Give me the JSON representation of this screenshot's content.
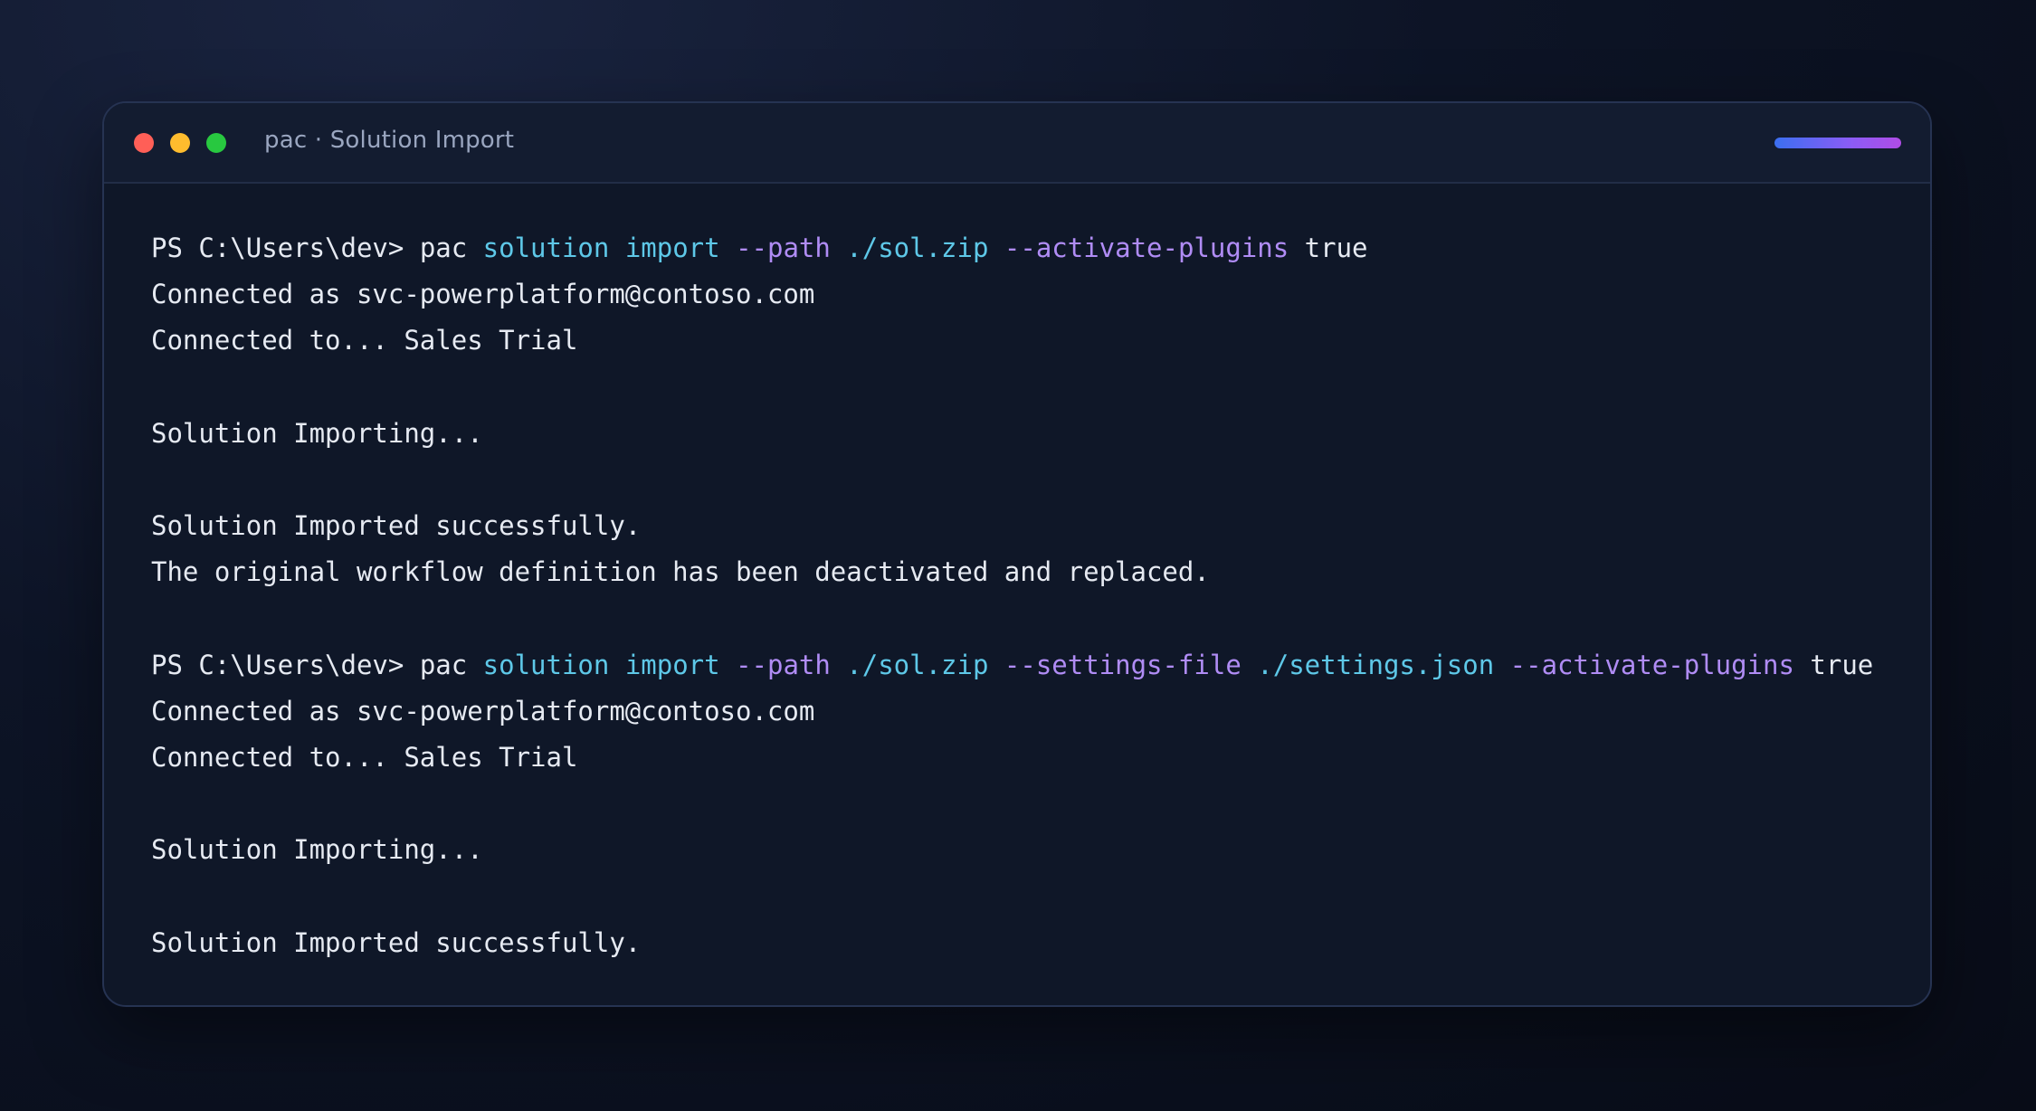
{
  "window": {
    "title": "pac · Solution Import"
  },
  "colors": {
    "command": "#5ec8e8",
    "flag": "#b08cf5",
    "text": "#e6eaf2",
    "close": "#ff5f57",
    "minimize": "#febc2e",
    "maximize": "#28c840"
  },
  "terminal": {
    "cmd1": {
      "prompt": "PS C:\\Users\\dev> ",
      "program": "pac",
      "sub1": "solution",
      "sub2": "import",
      "flag1": "--path",
      "arg1": "./sol.zip",
      "flag2": "--activate-plugins",
      "val2": "true"
    },
    "out1": [
      "Connected as svc-powerplatform@contoso.com",
      "Connected to... Sales Trial",
      "",
      "Solution Importing...",
      "",
      "Solution Imported successfully.",
      "The original workflow definition has been deactivated and replaced.",
      ""
    ],
    "cmd2": {
      "prompt": "PS C:\\Users\\dev> ",
      "program": "pac",
      "sub1": "solution",
      "sub2": "import",
      "flag1": "--path",
      "arg1": "./sol.zip",
      "flag2": "--settings-file",
      "arg2": "./settings.json",
      "flag3": "--activate-plugins",
      "val3": "true"
    },
    "out2": [
      "Connected as svc-powerplatform@contoso.com",
      "Connected to... Sales Trial",
      "",
      "Solution Importing...",
      "",
      "Solution Imported successfully."
    ]
  }
}
